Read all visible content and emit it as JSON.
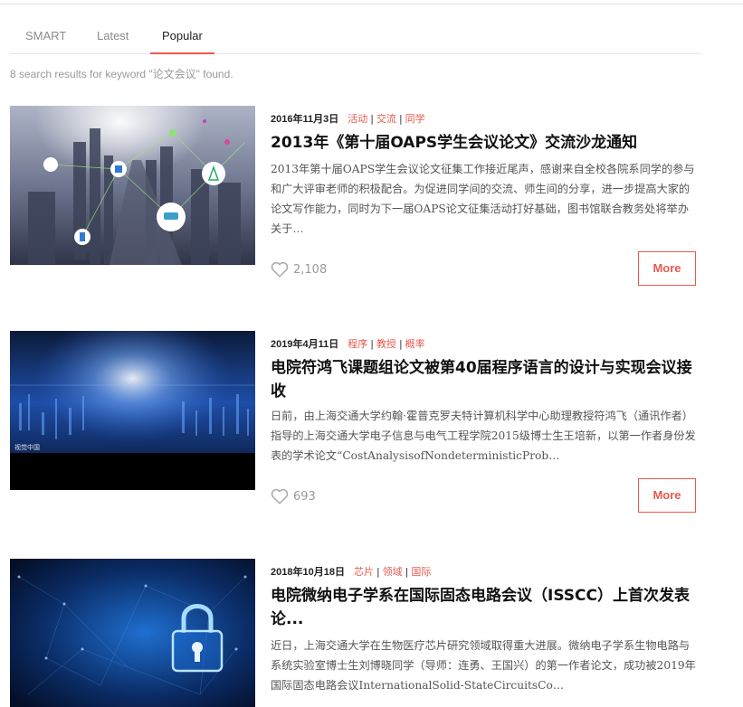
{
  "tabs": [
    {
      "label": "SMART"
    },
    {
      "label": "Latest"
    },
    {
      "label": "Popular"
    }
  ],
  "summary": "8 search results for keyword \"论文会议\" found.",
  "results": [
    {
      "date": "2016年11月3日",
      "tags": [
        "活动",
        "交流",
        "同学"
      ],
      "title": "2013年《第十届OAPS学生会议论文》交流沙龙通知",
      "excerpt": "2013年第十届OAPS学生会议论文征集工作接近尾声，感谢来自全校各院系同学的参与和广大评审老师的积极配合。为促进同学间的交流、师生间的分享，进一步提高大家的论文写作能力，同时为下一届OAPS论文征集活动打好基础，图书馆联合教务处将举办关于…",
      "likes": "2,108",
      "more_label": "More"
    },
    {
      "date": "2019年4月11日",
      "tags": [
        "程序",
        "教授",
        "概率"
      ],
      "title": "电院符鸿飞课题组论文被第40届程序语言的设计与实现会议接收",
      "excerpt": "日前，由上海交通大学约翰·霍普克罗夫特计算机科学中心助理教授符鸿飞（通讯作者）指导的上海交通大学电子信息与电气工程学院2015级博士生王培新，以第一作者身份发表的学术论文“CostAnalysisofNondeterministicProb…",
      "image_caption": "视觉中国",
      "likes": "693",
      "more_label": "More"
    },
    {
      "date": "2018年10月18日",
      "tags": [
        "芯片",
        "领域",
        "国际"
      ],
      "title": "电院微纳电子学系在国际固态电路会议（ISSCC）上首次发表论...",
      "excerpt": "近日，上海交通大学在生物医疗芯片研究领域取得重大进展。微纳电子学系生物电路与系统实验室博士生刘博晓同学（导师：连勇、王国兴）的第一作者论文，成功被2019年国际固态电路会议InternationalSolid-StateCircuitsCo…"
    }
  ],
  "colors": {
    "accent": "#e8594d",
    "muted": "#9a9a9a"
  }
}
